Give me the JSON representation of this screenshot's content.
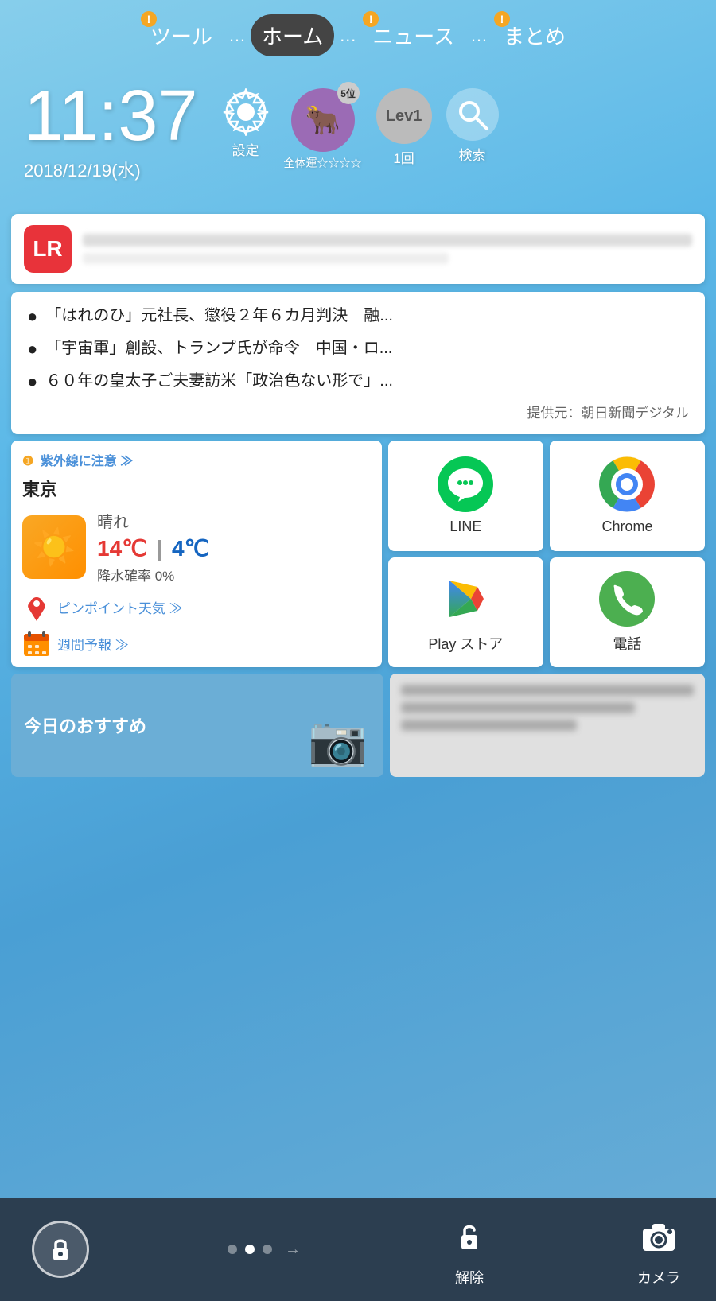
{
  "nav": {
    "items": [
      {
        "id": "tools",
        "label": "ツール",
        "active": false,
        "alert": true
      },
      {
        "id": "home",
        "label": "ホーム",
        "active": true,
        "alert": false
      },
      {
        "id": "news",
        "label": "ニュース",
        "active": false,
        "alert": true
      },
      {
        "id": "summary",
        "label": "まとめ",
        "active": false,
        "alert": true
      }
    ],
    "dots": "..."
  },
  "clock": {
    "time": "11:37",
    "date": "2018/12/19(水)"
  },
  "icons": {
    "settings_label": "設定",
    "horoscope_label": "全体運☆☆☆☆",
    "horoscope_rank": "5位",
    "lev_label": "1回",
    "lev_text": "Lev1",
    "search_label": "検索"
  },
  "notification": {
    "app_initial": "LR"
  },
  "news": {
    "items": [
      "「はれのひ」元社長、懲役２年６カ月判決　融...",
      "「宇宙軍」創設、トランプ氏が命令　中国・ロ...",
      "６０年の皇太子ご夫妻訪米「政治色ない形で」..."
    ],
    "source": "提供元：朝日新聞デジタル"
  },
  "weather": {
    "uv_alert": "❶",
    "uv_text": "紫外線に注意 ≫",
    "city": "東京",
    "condition": "晴れ",
    "temp_high": "14℃",
    "temp_sep": "|",
    "temp_low": "4℃",
    "rain": "降水確率 0%",
    "pinpoint_link": "ピンポイント天気 ≫",
    "weekly_link": "週間予報 ≫"
  },
  "apps": [
    {
      "id": "line",
      "label": "LINE",
      "type": "line"
    },
    {
      "id": "chrome",
      "label": "Chrome",
      "type": "chrome"
    },
    {
      "id": "playstore",
      "label": "Play ストア",
      "type": "play"
    },
    {
      "id": "phone",
      "label": "電話",
      "type": "phone"
    }
  ],
  "recommend": {
    "label": "今日のおすすめ"
  },
  "bottombar": {
    "unlock_label": "解除",
    "camera_label": "カメラ"
  }
}
